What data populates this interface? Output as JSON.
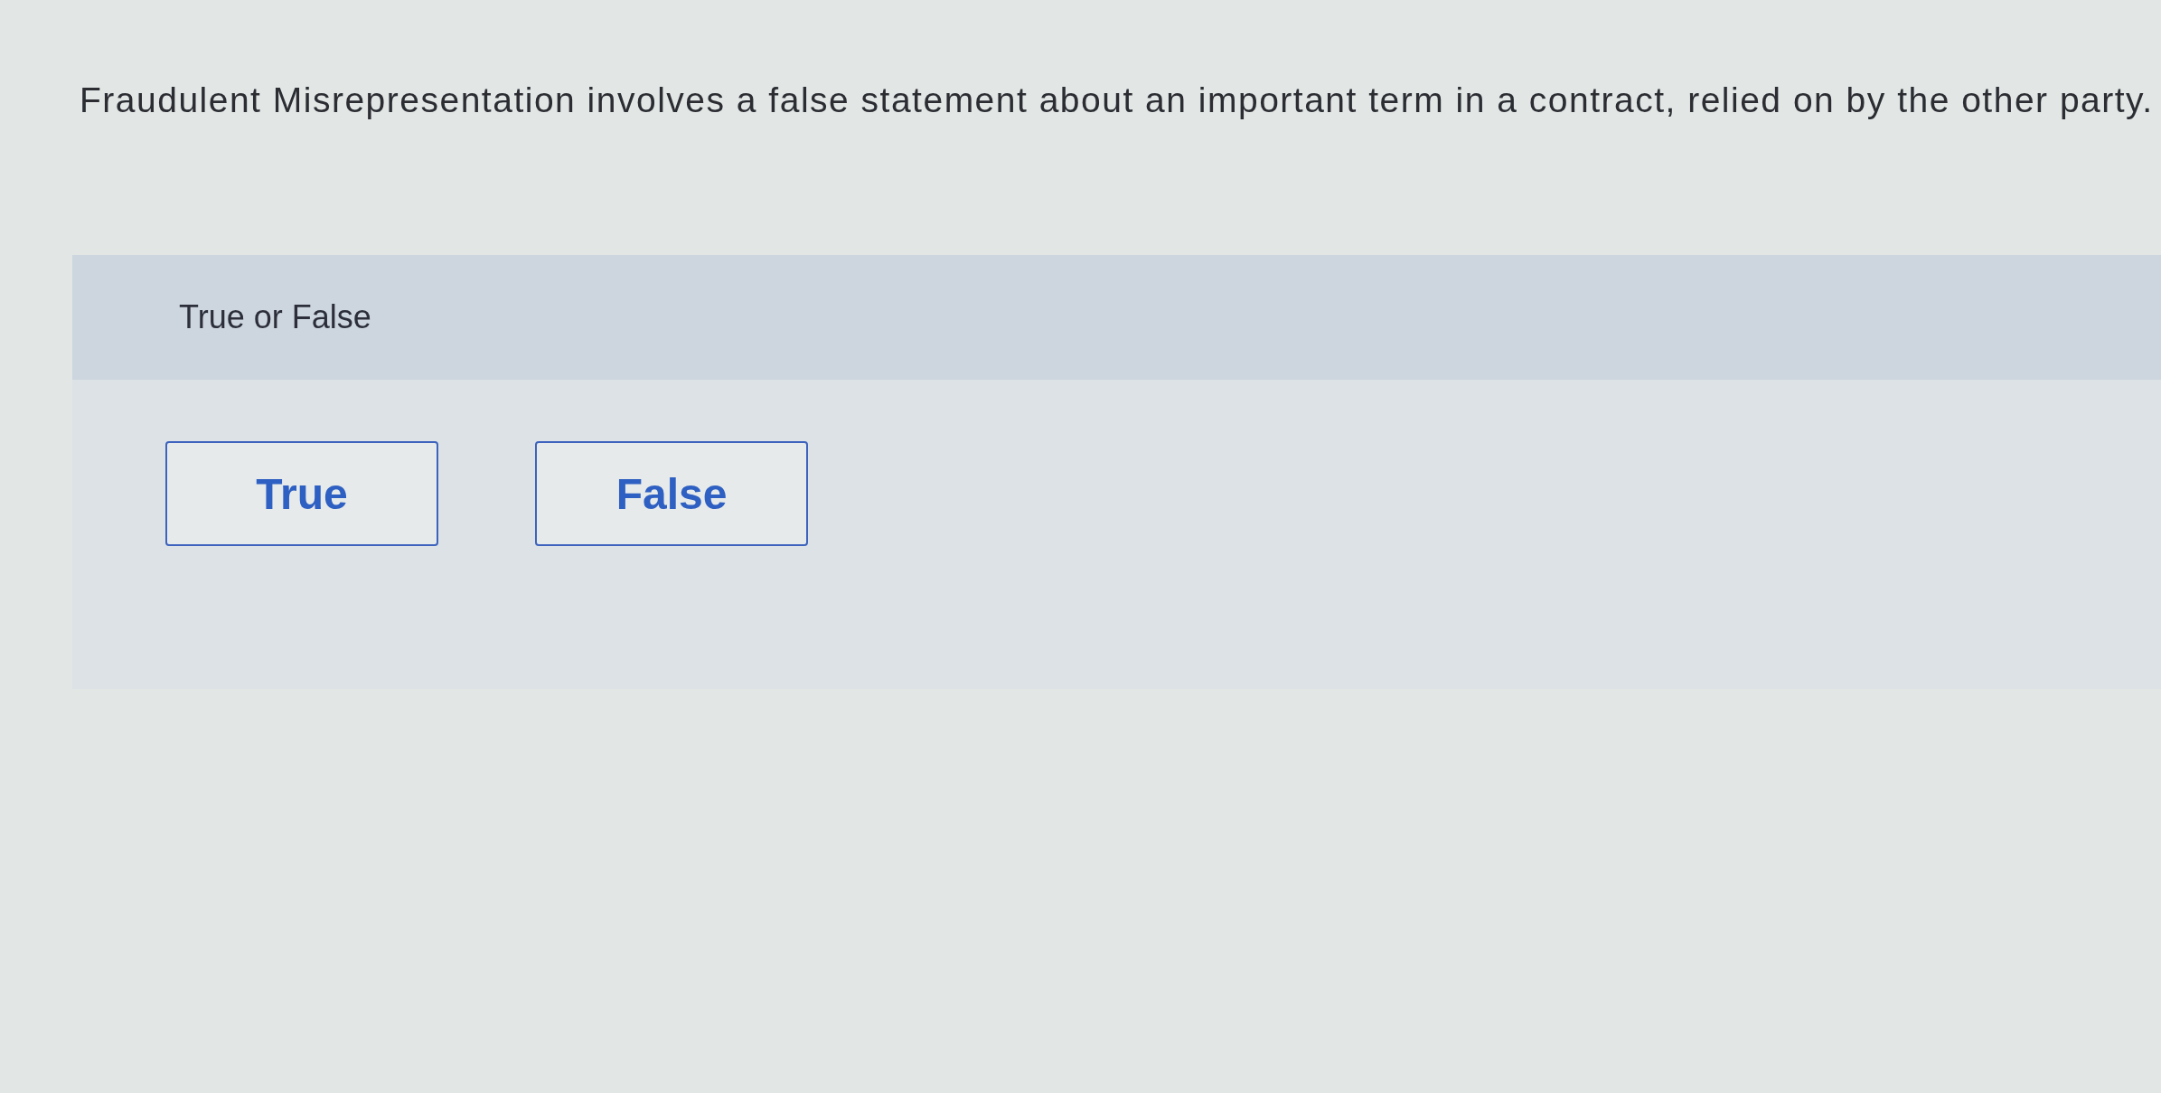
{
  "question": {
    "text": "Fraudulent Misrepresentation involves a false statement about an important term in a contract, relied on by the other party."
  },
  "answer_panel": {
    "instruction": "True or False",
    "options": [
      {
        "label": "True",
        "selected": false
      },
      {
        "label": "False",
        "selected": false
      }
    ]
  }
}
